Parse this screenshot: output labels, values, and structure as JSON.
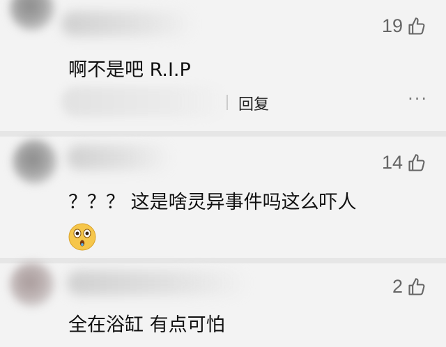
{
  "comments": [
    {
      "likes": "19",
      "text": "啊不是吧 R.I.P",
      "reply_label": "回复",
      "more_label": "···"
    },
    {
      "likes": "14",
      "text": "？？？ 这是啥灵异事件吗这么吓人",
      "emoji": "astonished-face"
    },
    {
      "likes": "2",
      "text": "全在浴缸 有点可怕"
    }
  ],
  "colors": {
    "background": "#f3f3f3",
    "divider": "#e6e6e6",
    "like_text": "#666666",
    "emoji_face": "#f6c64a"
  },
  "icons": {
    "like": "thumbs-up-icon",
    "more": "more-options-icon"
  }
}
